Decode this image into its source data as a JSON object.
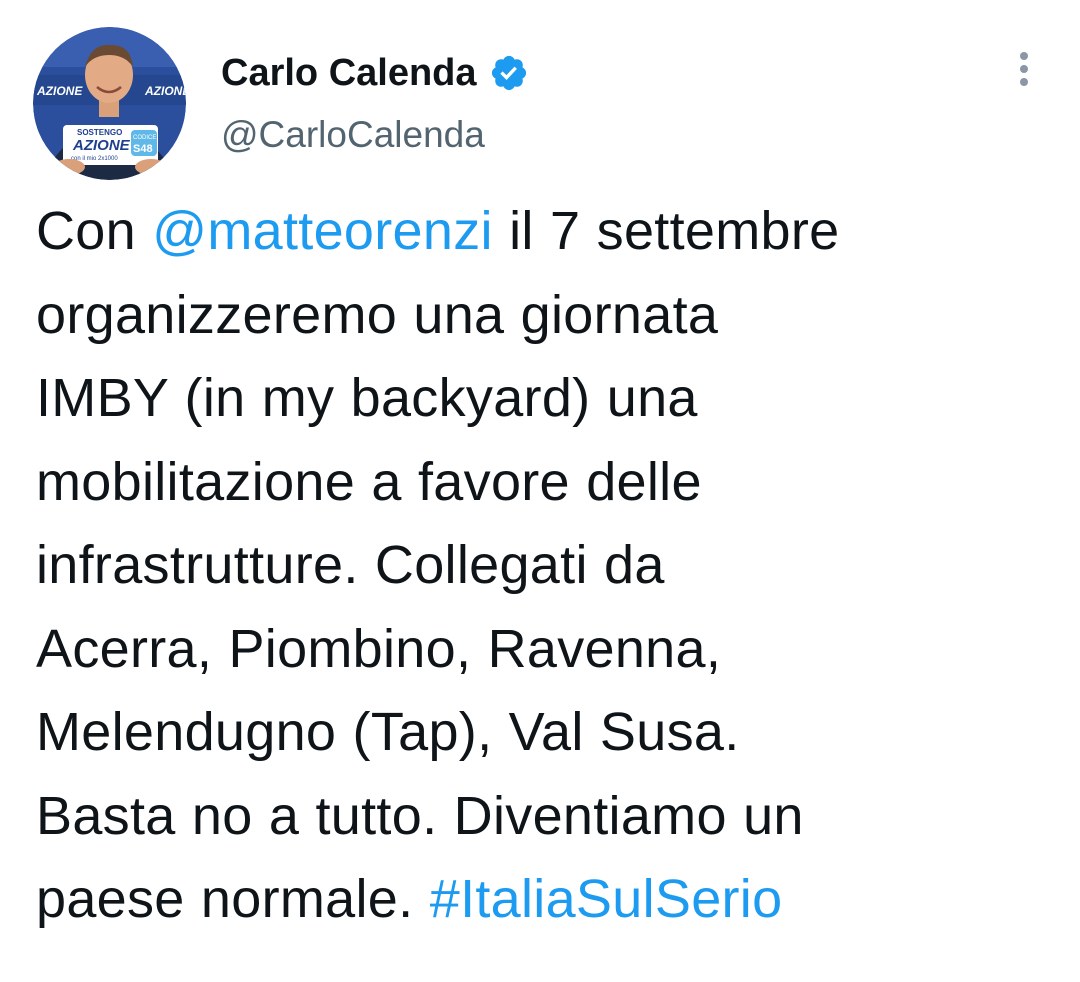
{
  "author": {
    "display_name": "Carlo Calenda",
    "handle": "@CarloCalenda",
    "verified_icon": "verified-badge-icon",
    "avatar": {
      "banner_texts": [
        "AZIONE",
        "AZIONE"
      ],
      "sign_texts": [
        "SOSTENGO",
        "AZIONE",
        "con il mio 2x1000",
        "CODICE",
        "S48"
      ]
    }
  },
  "menu": {
    "icon": "more-vertical-icon"
  },
  "tweet": {
    "lines": [
      [
        {
          "text": "Con "
        },
        {
          "text": "@matteorenzi",
          "type": "mention"
        },
        {
          "text": " il 7 settembre"
        }
      ],
      [
        {
          "text": "organizzeremo una giornata"
        }
      ],
      [
        {
          "text": "IMBY (in my backyard) una"
        }
      ],
      [
        {
          "text": "mobilitazione a favore delle"
        }
      ],
      [
        {
          "text": "infrastrutture. Collegati da"
        }
      ],
      [
        {
          "text": "Acerra, Piombino, Ravenna,"
        }
      ],
      [
        {
          "text": "Melendugno (Tap), Val Susa."
        }
      ],
      [
        {
          "text": "Basta no a tutto. Diventiamo un"
        }
      ],
      [
        {
          "text": "paese normale. "
        },
        {
          "text": "#ItaliaSulSerio",
          "type": "hashtag"
        }
      ]
    ]
  },
  "colors": {
    "link": "#1d9bf0",
    "text": "#0f1419",
    "secondary": "#536471",
    "verified": "#1d9bf0"
  }
}
